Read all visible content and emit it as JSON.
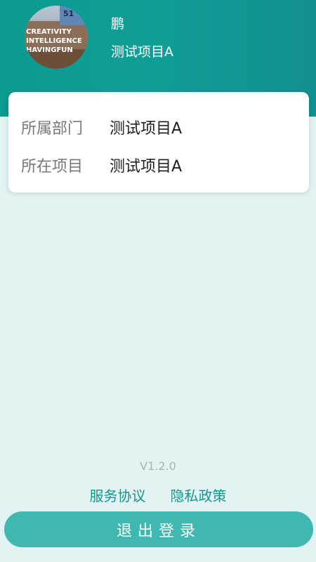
{
  "profile": {
    "name": "鹏",
    "project": "测试项目A"
  },
  "info": {
    "department_label": "所属部门",
    "department_value": "测试项目A",
    "project_label": "所在项目",
    "project_value": "测试项目A"
  },
  "footer": {
    "version": "V1.2.0",
    "service_agreement": "服务协议",
    "privacy_policy": "隐私政策",
    "logout": "退出登录"
  },
  "avatar_text": [
    "51",
    "CREATIVITY",
    "INTELLIGENCE",
    "HAVINGFUN"
  ],
  "colors": {
    "header": "#0f9f97",
    "background": "#e3f3f3",
    "accent": "#16958e",
    "logout_button": "#3fb9b0"
  }
}
